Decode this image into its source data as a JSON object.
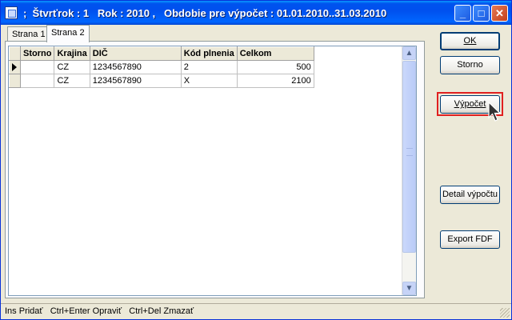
{
  "window": {
    "title": ";  Štvrťrok : 1   Rok : 2010 ,   Obdobie pre výpočet : 01.01.2010..31.03.2010",
    "controls": {
      "minimize": "_",
      "maximize": "□",
      "close": "✕"
    }
  },
  "tabs": [
    {
      "label": "Strana 1"
    },
    {
      "label": "Strana 2"
    }
  ],
  "grid": {
    "columns": [
      "Storno",
      "Krajina",
      "DIČ",
      "Kód plnenia",
      "Celkom"
    ],
    "rows": [
      {
        "storno": "",
        "krajina": "CZ",
        "dic": "1234567890",
        "kod": "2",
        "celkom": "500"
      },
      {
        "storno": "",
        "krajina": "CZ",
        "dic": "1234567890",
        "kod": "X",
        "celkom": "2100"
      }
    ]
  },
  "buttons": {
    "ok": "OK",
    "storno": "Storno",
    "vypocet": "Výpočet",
    "detail": "Detail výpočtu",
    "export": "Export FDF"
  },
  "statusbar": {
    "text": "Ins Pridať   Ctrl+Enter Opraviť   Ctrl+Del Zmazať"
  },
  "colors": {
    "highlight": "#e02020",
    "titlebar": "#0053ee"
  }
}
